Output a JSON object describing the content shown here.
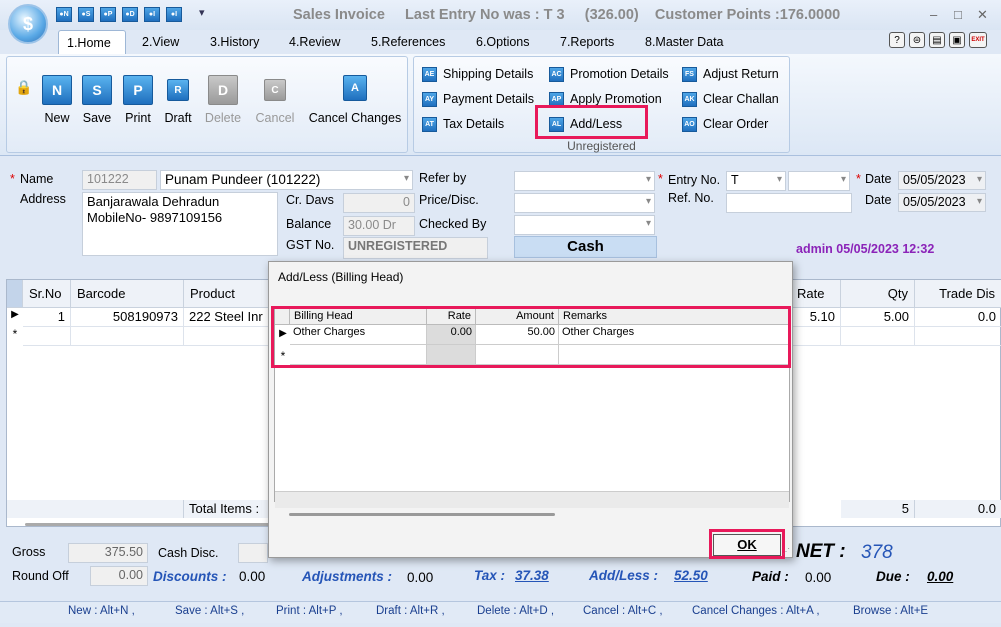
{
  "window": {
    "title": "Sales Invoice",
    "last_entry": "Last Entry No was : T 3",
    "last_amount": "(326.00)",
    "customer_points": "Customer Points :176.0000",
    "min": "–",
    "max": "□",
    "close": "✕"
  },
  "quick_access": [
    "●N",
    "●S",
    "●P",
    "●D",
    "●I",
    "●I"
  ],
  "tabs": [
    "1.Home",
    "2.View",
    "3.History",
    "4.Review",
    "5.References",
    "6.Options",
    "7.Reports",
    "8.Master Data"
  ],
  "ribbon": {
    "big_buttons": [
      {
        "icon": "N",
        "label": "New"
      },
      {
        "icon": "S",
        "label": "Save"
      },
      {
        "icon": "P",
        "label": "Print"
      },
      {
        "icon": "R",
        "label": "Draft"
      },
      {
        "icon": "D",
        "label": "Delete"
      },
      {
        "icon": "C",
        "label": "Cancel"
      },
      {
        "icon": "A",
        "label": "Cancel Changes"
      }
    ],
    "col1": [
      {
        "icon": "AE",
        "label": "Shipping Details"
      },
      {
        "icon": "AY",
        "label": "Payment Details"
      },
      {
        "icon": "AT",
        "label": "Tax Details"
      }
    ],
    "col2": [
      {
        "icon": "AC",
        "label": "Promotion Details"
      },
      {
        "icon": "AP",
        "label": "Apply Promotion"
      },
      {
        "icon": "AL",
        "label": "Add/Less"
      }
    ],
    "col3": [
      {
        "icon": "FS",
        "label": "Adjust Return"
      },
      {
        "icon": "AK",
        "label": "Clear Challan"
      },
      {
        "icon": "AO",
        "label": "Clear Order"
      }
    ],
    "group_label": "Unregistered",
    "help_icons": [
      "?",
      "⊜",
      "▤",
      "▣",
      "EXIT"
    ]
  },
  "form": {
    "name_label": "Name",
    "name_code": "101222",
    "name_value": "Punam Pundeer (101222)",
    "address_label": "Address",
    "address_line1": "Banjarawala Dehradun",
    "address_line2": "MobileNo- 9897109156",
    "cr_days_label": "Cr. Davs",
    "cr_days": "0",
    "balance_label": "Balance",
    "balance": "30.00 Dr",
    "gst_label": "GST No.",
    "gst": "UNREGISTERED",
    "refer_label": "Refer by",
    "price_label": "Price/Disc.",
    "checked_label": "Checked By",
    "cash": "Cash",
    "entry_label": "Entry No.",
    "entry_value": "T",
    "ref_label": "Ref. No.",
    "date_label": "Date",
    "date1": "05/05/2023",
    "date2": "05/05/2023",
    "admin": "admin 05/05/2023 12:32"
  },
  "grid": {
    "headers": [
      "Sr.No",
      "Barcode",
      "Product",
      "Rate",
      "Qty",
      "Trade Dis"
    ],
    "row": {
      "sr": "1",
      "barcode": "508190973",
      "product": "222 Steel Inr",
      "rate": "5.10",
      "qty": "5.00",
      "disc": "0.0"
    },
    "new_marker": "*",
    "total_items": "Total Items :",
    "total_qty": "5",
    "total_disc": "0.0"
  },
  "totals": {
    "gross_label": "Gross",
    "gross": "375.50",
    "cash_disc_label": "Cash Disc.",
    "round_label": "Round Off",
    "round": "0.00",
    "discounts_label": "Discounts :",
    "discounts": "0.00",
    "adjustments_label": "Adjustments :",
    "adjustments": "0.00",
    "tax_label": "Tax :",
    "tax": "37.38",
    "addless_label": "Add/Less :",
    "addless": "52.50",
    "paid_label": "Paid :",
    "paid": "0.00",
    "due_label": "Due :",
    "due": "0.00",
    "net_label": "NET :",
    "net": "378"
  },
  "shortcuts": [
    "New : Alt+N ,",
    "Save : Alt+S ,",
    "Print : Alt+P ,",
    "Draft : Alt+R ,",
    "Delete : Alt+D ,",
    "Cancel : Alt+C ,",
    "Cancel Changes : Alt+A ,",
    "Browse : Alt+E"
  ],
  "dialog": {
    "title": "Add/Less (Billing Head)",
    "headers": [
      "Billing Head",
      "Rate",
      "Amount",
      "Remarks"
    ],
    "row": {
      "head": "Other Charges",
      "rate": "0.00",
      "amount": "50.00",
      "remarks": "Other Charges"
    },
    "new_marker": "*",
    "ok": "OK"
  }
}
